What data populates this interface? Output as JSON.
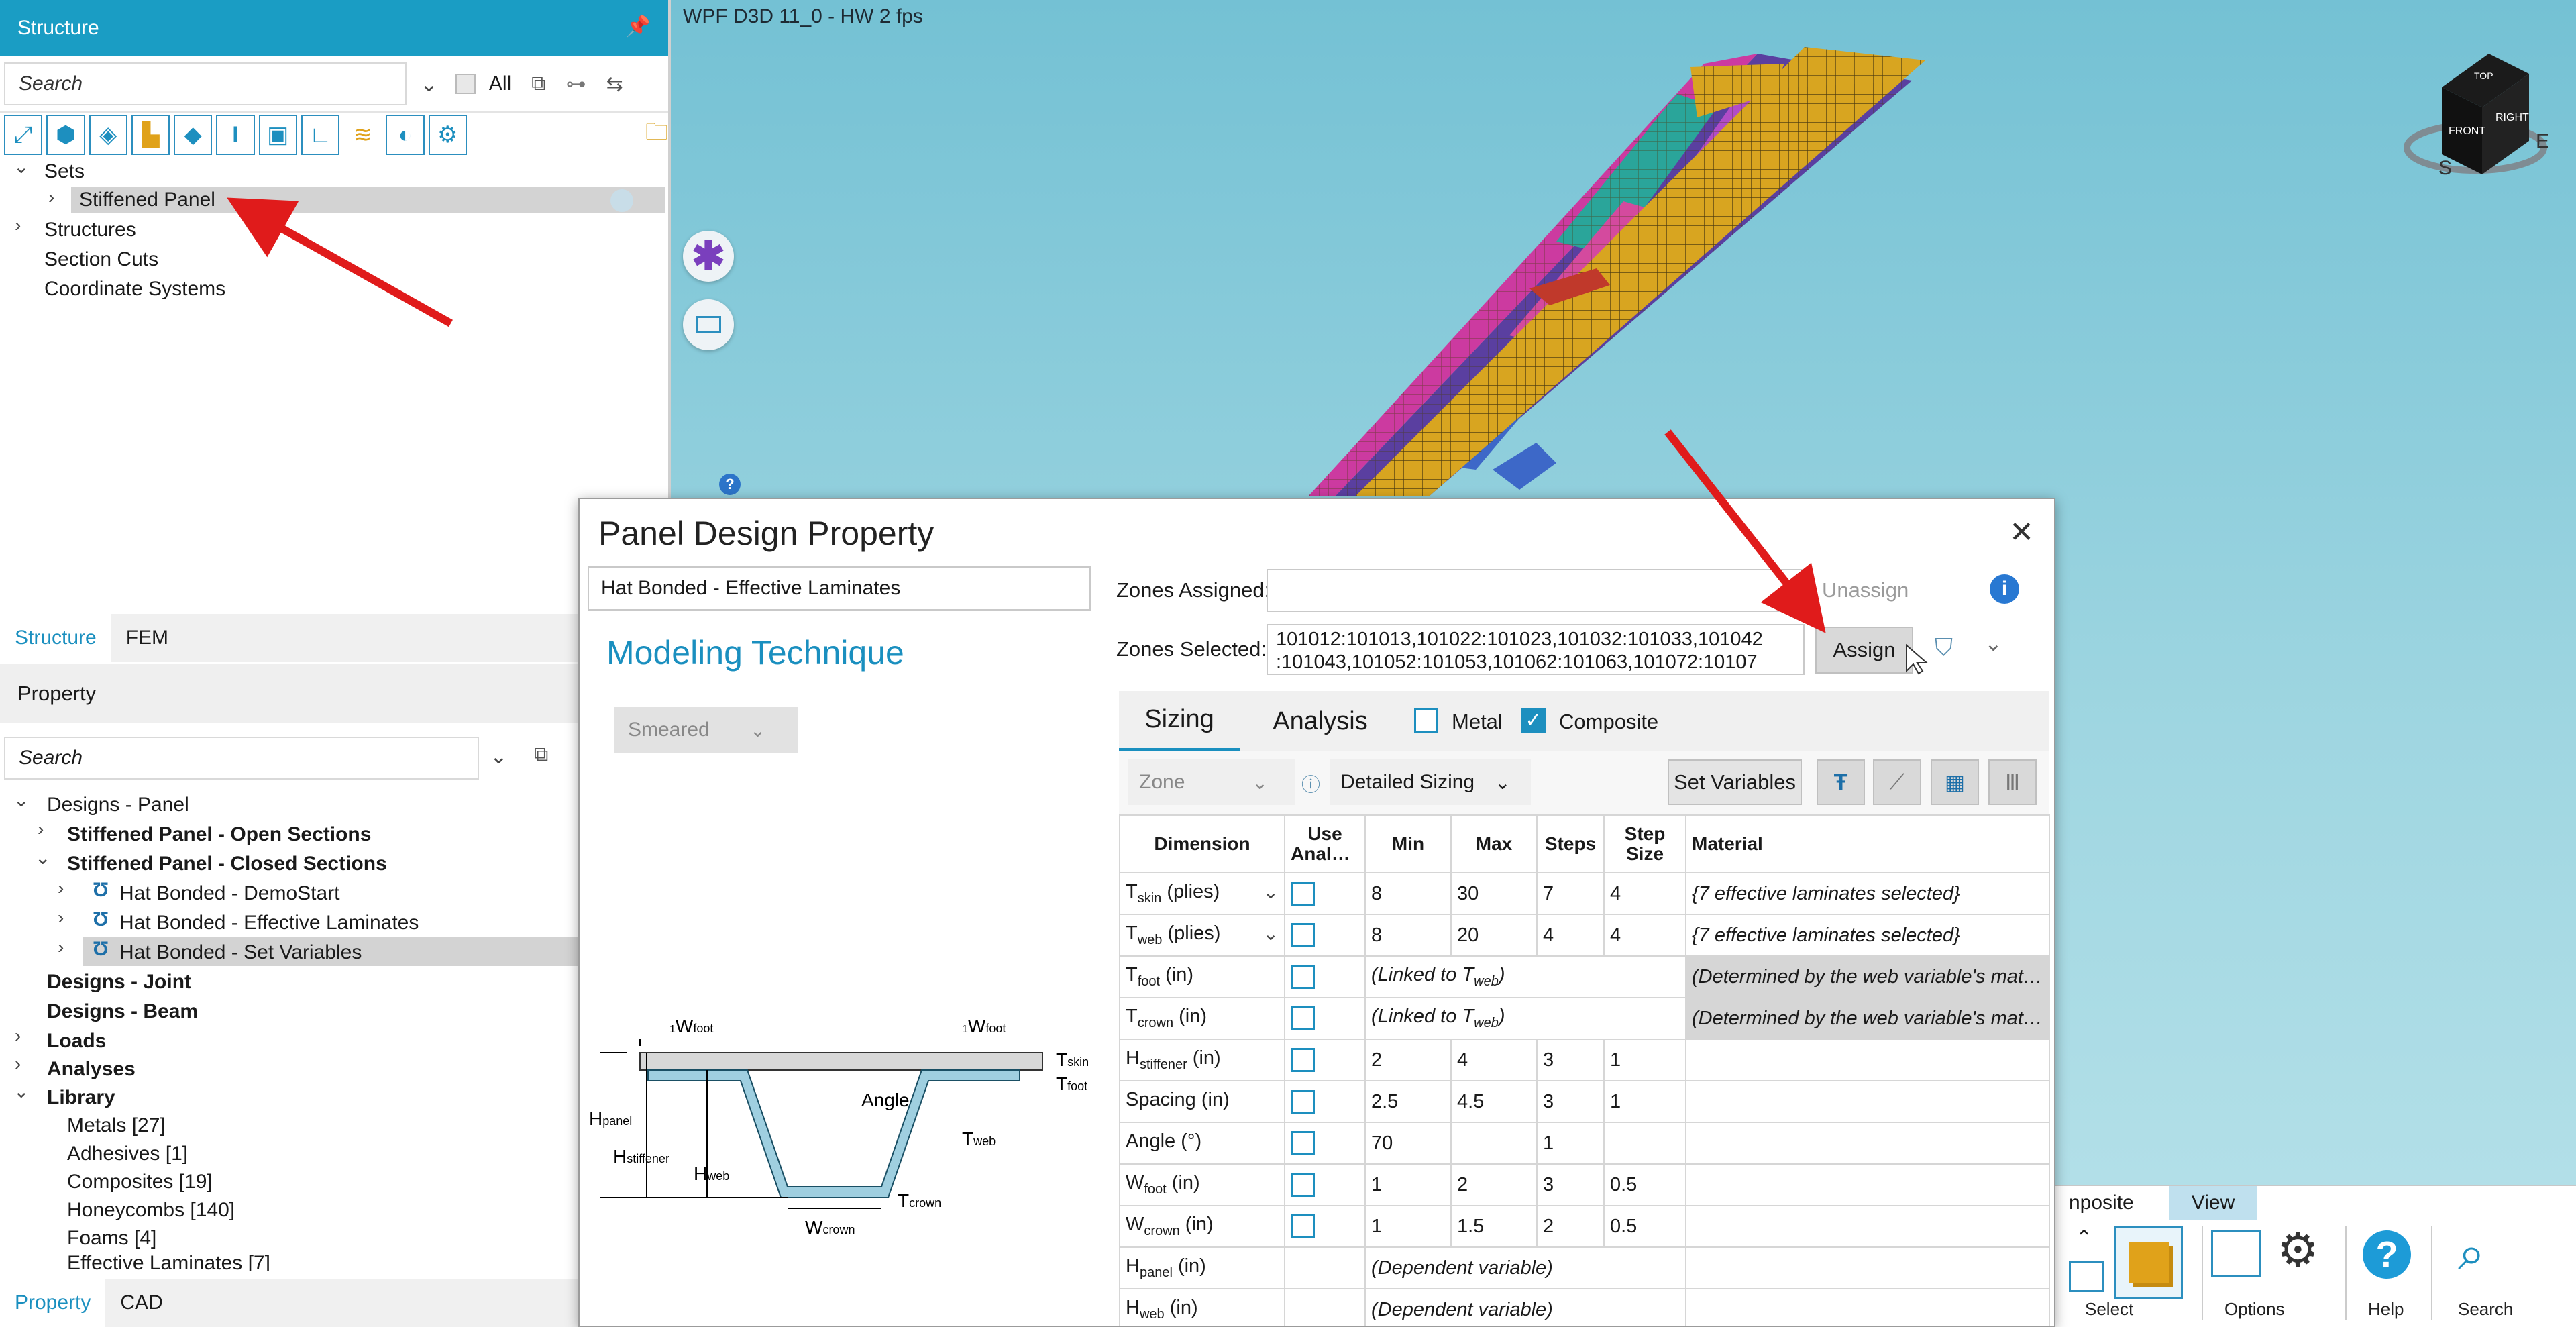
{
  "viewport": {
    "title": "WPF D3D 11_0 - HW  2 fps",
    "cube_faces": [
      "TOP",
      "FRONT",
      "RIGHT"
    ],
    "compass": [
      "S",
      "E"
    ]
  },
  "structure": {
    "header": "Structure",
    "search_placeholder": "Search",
    "all_label": "All",
    "tree": [
      {
        "label": "Sets",
        "bold": false
      },
      {
        "label": "Stiffened Panel"
      },
      {
        "label": "Structures"
      },
      {
        "label": "Section Cuts"
      },
      {
        "label": "Coordinate Systems"
      }
    ],
    "tabs": [
      "Structure",
      "FEM"
    ]
  },
  "property": {
    "header": "Property",
    "search_placeholder": "Search",
    "tree": [
      "Designs - Panel",
      "Stiffened Panel - Open Sections",
      "Stiffened Panel - Closed Sections",
      "Hat Bonded - DemoStart",
      "Hat Bonded - Effective Laminates",
      "Hat Bonded - Set Variables",
      "Designs - Joint",
      "Designs - Beam",
      "Loads",
      "Analyses",
      "Library",
      "Metals [27]",
      "Adhesives [1]",
      "Composites [19]",
      "Honeycombs [140]",
      "Foams [4]",
      "Effective Laminates [7]"
    ],
    "tabs": [
      "Property",
      "CAD"
    ]
  },
  "dialog": {
    "title": "Panel Design Property",
    "property_name": "Hat Bonded - Effective Laminates",
    "modeling_technique_label": "Modeling Technique",
    "modeling_technique_value": "Smeared",
    "zones_assigned_label": "Zones Assigned:",
    "zones_assigned_value": "",
    "unassign_label": "Unassign",
    "zones_selected_label": "Zones Selected:",
    "zones_selected_line1": "101012:101013,101022:101023,101032:101033,101042",
    "zones_selected_line2": ":101043,101052:101053,101062:101063,101072:10107",
    "assign_label": "Assign",
    "tabs": [
      "Sizing",
      "Analysis"
    ],
    "metal_label": "Metal",
    "metal_checked": false,
    "composite_label": "Composite",
    "composite_checked": true,
    "zone_dropdown": "Zone",
    "sizing_dropdown": "Detailed Sizing",
    "set_variables_label": "Set Variables",
    "grid_headers": [
      "Dimension",
      "Use Analysis",
      "Min",
      "Max",
      "Steps",
      "Step Size",
      "Material"
    ],
    "rows": [
      {
        "dim": "T",
        "sub": "skin",
        "unit": " (plies)",
        "dropdown": true,
        "checkbox": true,
        "min": "8",
        "max": "30",
        "steps": "7",
        "step_size": "4",
        "material": "{7 effective laminates selected}",
        "material_grey": false
      },
      {
        "dim": "T",
        "sub": "web",
        "unit": " (plies)",
        "dropdown": true,
        "checkbox": true,
        "min": "8",
        "max": "20",
        "steps": "4",
        "step_size": "4",
        "material": "{7 effective laminates selected}",
        "material_grey": false
      },
      {
        "dim": "T",
        "sub": "foot",
        "unit": " (in)",
        "checkbox": true,
        "linked": "(Linked to T",
        "linked_sub": "web",
        "material": "(Determined by the web variable's mater...",
        "material_grey": true
      },
      {
        "dim": "T",
        "sub": "crown",
        "unit": " (in)",
        "checkbox": true,
        "linked": "(Linked to T",
        "linked_sub": "web",
        "material": "(Determined by the web variable's mater...",
        "material_grey": true
      },
      {
        "dim": "H",
        "sub": "stiffener",
        "unit": " (in)",
        "checkbox": true,
        "min": "2",
        "max": "4",
        "steps": "3",
        "step_size": "1",
        "material": ""
      },
      {
        "dim": "Spacing",
        "sub": "",
        "unit": " (in)",
        "checkbox": true,
        "min": "2.5",
        "max": "4.5",
        "steps": "3",
        "step_size": "1",
        "material": ""
      },
      {
        "dim": "Angle",
        "sub": "",
        "unit": " (°)",
        "checkbox": true,
        "min": "70",
        "max": "",
        "steps": "1",
        "step_size": "",
        "material": ""
      },
      {
        "dim": "W",
        "sub": "foot",
        "unit": " (in)",
        "checkbox": true,
        "min": "1",
        "max": "2",
        "steps": "3",
        "step_size": "0.5",
        "material": ""
      },
      {
        "dim": "W",
        "sub": "crown",
        "unit": " (in)",
        "checkbox": true,
        "min": "1",
        "max": "1.5",
        "steps": "2",
        "step_size": "0.5",
        "material": ""
      },
      {
        "dim": "H",
        "sub": "panel",
        "unit": " (in)",
        "checkbox": false,
        "dependent": "(Dependent variable)"
      },
      {
        "dim": "H",
        "sub": "web",
        "unit": " (in)",
        "checkbox": false,
        "dependent": "(Dependent variable)"
      }
    ],
    "diagram_labels": {
      "half": "1",
      "half_den": "2",
      "w": "W",
      "foot": "foot",
      "crown": "crown",
      "t": "T",
      "skin": "skin",
      "web": "web",
      "h": "H",
      "panel": "panel",
      "stiffener": "stiffener",
      "angle": "Angle"
    }
  },
  "ribbon": {
    "tabs": [
      "nposite",
      "View"
    ],
    "buttons": [
      "Select",
      "Options",
      "Help",
      "Search"
    ]
  }
}
